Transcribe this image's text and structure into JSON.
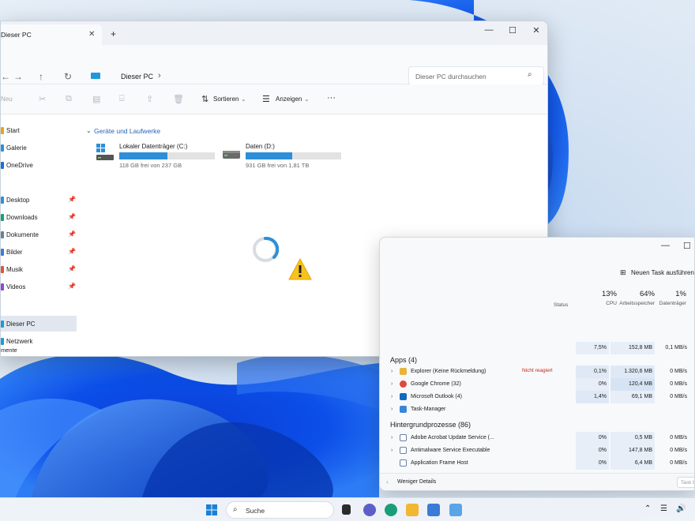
{
  "explorer": {
    "tab_title": "Dieser PC",
    "tab_close": "✕",
    "tab_add": "+",
    "window_controls": [
      "—",
      "☐",
      "✕"
    ],
    "nav_icons": [
      "←",
      "→",
      "↑",
      "↻"
    ],
    "address": "Dieser PC",
    "address_chevron": "›",
    "search_placeholder": "Dieser PC durchsuchen",
    "search_icon": "⌕",
    "commands": {
      "new_label": "Neu",
      "sort_label": "Sortieren",
      "view_label": "Anzeigen",
      "more": "···",
      "sort_icon": "⇅",
      "view_icon": "☰",
      "chevron": "⌄"
    },
    "sidebar": [
      {
        "label": "Start",
        "color": "#e8a317"
      },
      {
        "label": "Galerie",
        "color": "#2d8fd8"
      },
      {
        "label": "OneDrive",
        "color": "#1f6fd0"
      },
      {
        "label": "Desktop",
        "color": "#2d8fd8",
        "pinned": true
      },
      {
        "label": "Downloads",
        "color": "#1f9e6e",
        "pinned": true
      },
      {
        "label": "Dokumente",
        "color": "#6e7f96",
        "pinned": true
      },
      {
        "label": "Bilder",
        "color": "#3b7ed6",
        "pinned": true
      },
      {
        "label": "Musik",
        "color": "#e0533b",
        "pinned": true
      },
      {
        "label": "Videos",
        "color": "#8a4ad6",
        "pinned": true
      },
      {
        "label": "Dieser PC",
        "color": "#1f9ad7",
        "active": true
      },
      {
        "label": "Netzwerk",
        "color": "#1f9ad7"
      }
    ],
    "pin_icon": "📌",
    "section_title": "Geräte und Laufwerke",
    "section_chevron": "⌄",
    "drives": [
      {
        "name": "Lokaler Datenträger (C:)",
        "free": "118 GB frei von 237 GB",
        "used_fraction": 0.5
      },
      {
        "name": "Daten (D:)",
        "free": "931 GB frei von 1,81 TB",
        "used_fraction": 0.49
      }
    ],
    "status_left": "mente",
    "view_icons": [
      "≣",
      "▢"
    ]
  },
  "taskmgr": {
    "window_controls": [
      "—",
      "☐"
    ],
    "new_task_label": "Neuen Task ausführen",
    "new_task_icon": "⊞",
    "columns": {
      "status": "Status",
      "cpu_pct": "13%",
      "cpu": "CPU",
      "mem_pct": "64%",
      "mem": "Arbeitsspeicher",
      "disk_pct": "1%",
      "disk": "Datenträger"
    },
    "top_row": {
      "cpu": "7,5%",
      "mem": "152,8 MB",
      "disk": "0,1 MB/s"
    },
    "apps_header": "Apps (4)",
    "apps": [
      {
        "name": "Explorer (Keine Rückmeldung)",
        "status": "Nicht reagiert",
        "cpu": "0,1%",
        "mem": "1.320,6 MB",
        "disk": "0 MB/s",
        "color": "#e8b53a"
      },
      {
        "name": "Google Chrome (32)",
        "status": "",
        "cpu": "0%",
        "mem": "120,4 MB",
        "disk": "0 MB/s",
        "color": "#de4b39"
      },
      {
        "name": "Microsoft Outlook (4)",
        "status": "",
        "cpu": "1,4%",
        "mem": "69,1 MB",
        "disk": "0 MB/s",
        "color": "#0f6cbd"
      },
      {
        "name": "Task-Manager",
        "status": "",
        "cpu": "",
        "mem": "",
        "disk": "",
        "color": "#3a86d6"
      }
    ],
    "bg_header": "Hintergrundprozesse (86)",
    "background": [
      {
        "name": "Adobe Acrobat Update Service (...",
        "cpu": "0%",
        "mem": "0,5 MB",
        "disk": "0 MB/s",
        "color": "#6a7fa3"
      },
      {
        "name": "Antimalware Service Executable",
        "cpu": "0%",
        "mem": "147,8 MB",
        "disk": "0 MB/s",
        "color": "#6a7fa3"
      },
      {
        "name": "Application Frame Host",
        "cpu": "0%",
        "mem": "6,4 MB",
        "disk": "0 MB/s",
        "color": "#6a7fa3"
      }
    ],
    "less_details": "Weniger Details",
    "end_task": "Task b",
    "expand_chevron": "›"
  },
  "taskbar": {
    "search_label": "Suche",
    "search_icon": "⌕",
    "tray_icons": [
      "⌃",
      "☰",
      "🔊"
    ]
  }
}
